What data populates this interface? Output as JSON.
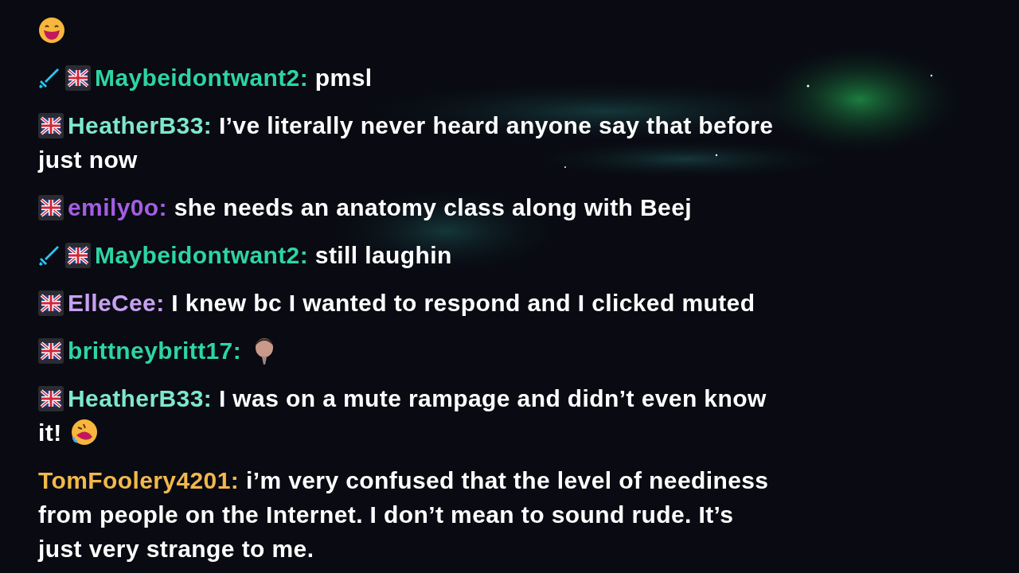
{
  "messages": [
    {
      "sword_badge": false,
      "flag_badge": false,
      "emote": {
        "kind": "grin"
      }
    },
    {
      "sword_badge": true,
      "flag_badge": true,
      "name": "Maybeidontwant2:",
      "color": "#2dd4a6",
      "text": "pmsl"
    },
    {
      "sword_badge": false,
      "flag_badge": true,
      "name": "HeatherB33:",
      "color": "#7ee8cb",
      "text": "I’ve literally never heard anyone say that before just now"
    },
    {
      "sword_badge": false,
      "flag_badge": true,
      "name": "emily0o:",
      "color": "#a35ee3",
      "text": "she needs an anatomy class along with Beej"
    },
    {
      "sword_badge": true,
      "flag_badge": true,
      "name": "Maybeidontwant2:",
      "color": "#2dd4a6",
      "text": "still laughin"
    },
    {
      "sword_badge": false,
      "flag_badge": true,
      "name": "ElleCee:",
      "color": "#c7a0f2",
      "text": "I knew bc I wanted to respond and I clicked muted"
    },
    {
      "sword_badge": false,
      "flag_badge": true,
      "name": "brittneybritt17:",
      "color": "#2dd4a6",
      "emote": {
        "kind": "portrait"
      }
    },
    {
      "sword_badge": false,
      "flag_badge": true,
      "name": "HeatherB33:",
      "color": "#7ee8cb",
      "text": "I was on a mute rampage and didn’t even know it!",
      "emote": {
        "kind": "rofl"
      }
    },
    {
      "sword_badge": false,
      "flag_badge": false,
      "name": "TomFoolery4201:",
      "color": "#f2b84a",
      "text": "i’m very confused that the level of neediness from people on the Internet. I don’t mean to sound rude. It’s just very strange to me."
    }
  ]
}
